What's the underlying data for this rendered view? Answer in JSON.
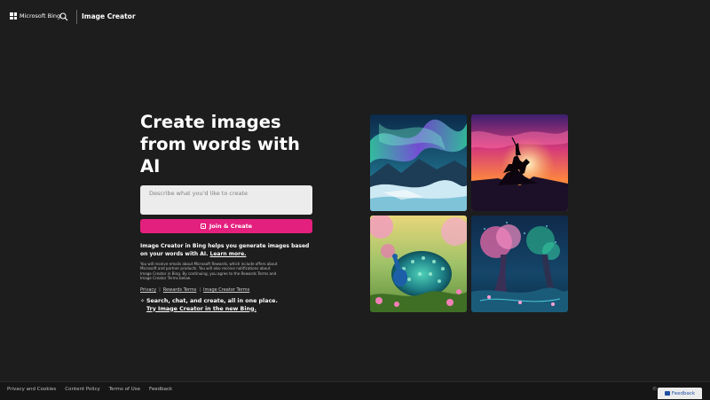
{
  "header": {
    "brand": "Microsoft Bing",
    "title": "Image Creator"
  },
  "main": {
    "hero_title": "Create images from words with AI",
    "prompt_placeholder": "Describe what you'd like to create",
    "join_button": "Join & Create",
    "description": "Image Creator in Bing helps you generate images based on your words with AI.",
    "learn_more": "Learn more.",
    "fine_print": "You will receive emails about Microsoft Rewards, which include offers about Microsoft and partner products. You will also receive notifications about Image Creator in Bing. By continuing, you agree to the Rewards Terms and Image Creator Terms below.",
    "legal_links": [
      "Privacy",
      "Rewards Terms",
      "Image Creator Terms"
    ],
    "legal_sep": "|",
    "promo_text": "Search, chat, and create, all in one place.",
    "promo_link": "Try Image Creator in the new Bing."
  },
  "gallery": [
    {
      "name": "aurora-landscape"
    },
    {
      "name": "horse-rider-sunset"
    },
    {
      "name": "peacock-garden"
    },
    {
      "name": "glowing-forest"
    }
  ],
  "footer": {
    "links": [
      "Privacy and Cookies",
      "Content Policy",
      "Terms of Use",
      "Feedback"
    ],
    "copyright": "©",
    "feedback_button": "Feedback"
  },
  "colors": {
    "background": "#1d1d1d",
    "accent": "#e3207e"
  }
}
